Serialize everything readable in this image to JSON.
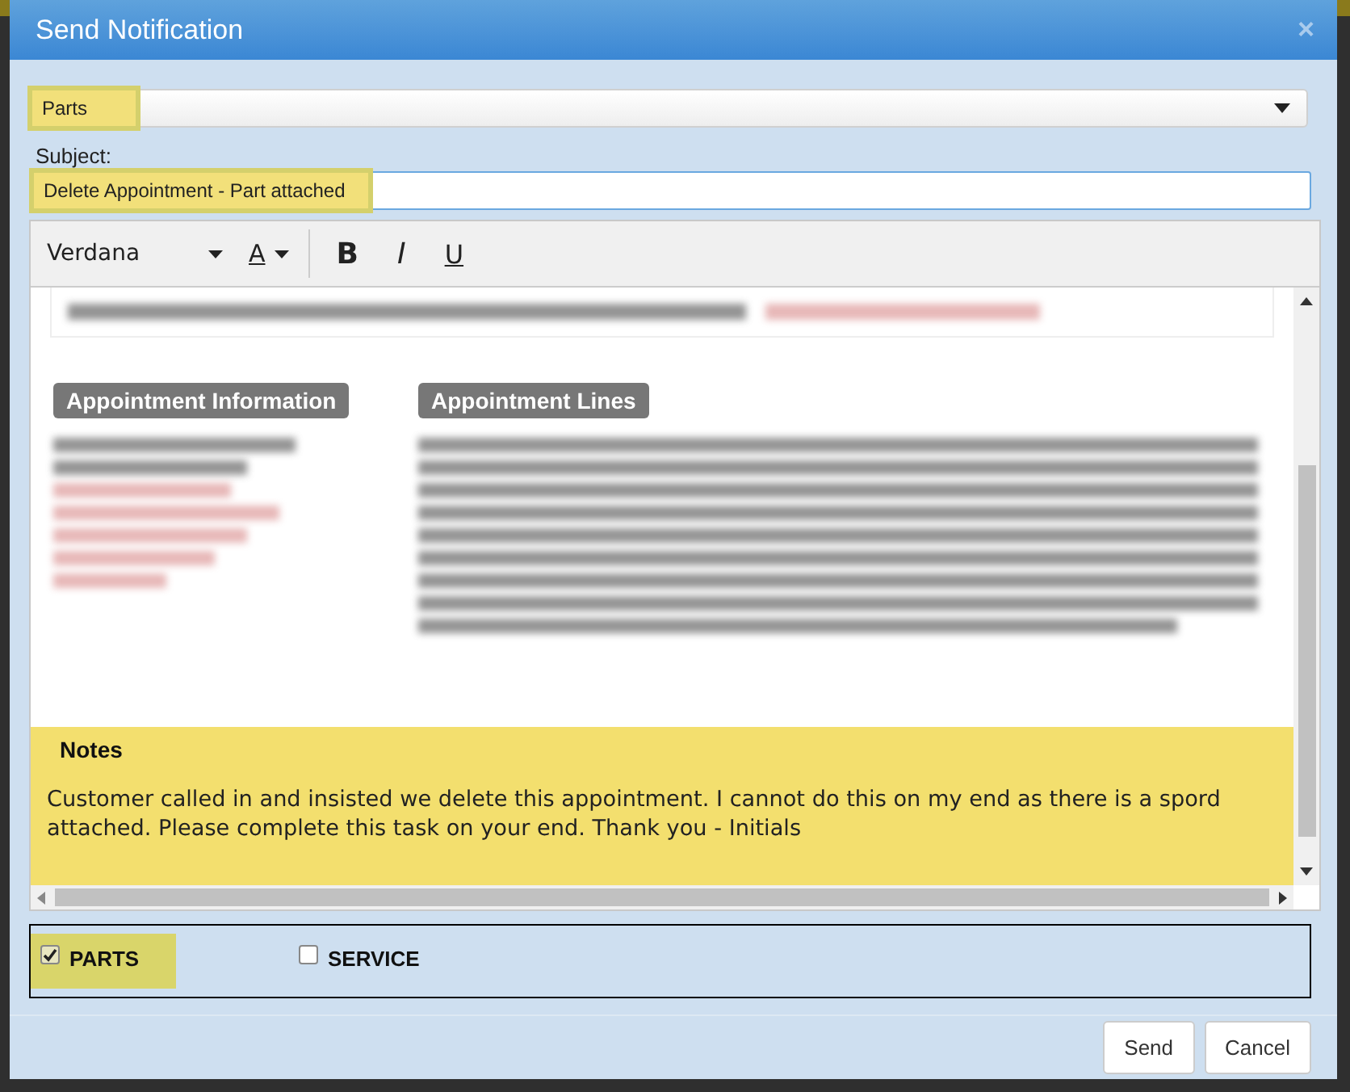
{
  "dialog": {
    "title": "Send Notification",
    "close": "×"
  },
  "recipient_select": {
    "value": "Parts",
    "highlighted": true
  },
  "subject": {
    "label": "Subject:",
    "value": "Delete Appointment - Part attached",
    "highlighted": true
  },
  "editor_toolbar": {
    "font": "Verdana",
    "color_letter": "A",
    "bold": "B",
    "italic": "I",
    "underline": "U"
  },
  "editor_content": {
    "section_labels": [
      "Appointment Information",
      "Appointment Lines"
    ],
    "notes_heading": "Notes",
    "notes_text": "Customer called in and insisted we delete this appointment. I cannot do this on my end as there is a spord attached. Please complete this task on your end. Thank you - Initials"
  },
  "departments": [
    {
      "label": "PARTS",
      "checked": true,
      "highlighted": true
    },
    {
      "label": "SERVICE",
      "checked": false,
      "highlighted": false
    }
  ],
  "buttons": [
    "Send",
    "Cancel"
  ]
}
